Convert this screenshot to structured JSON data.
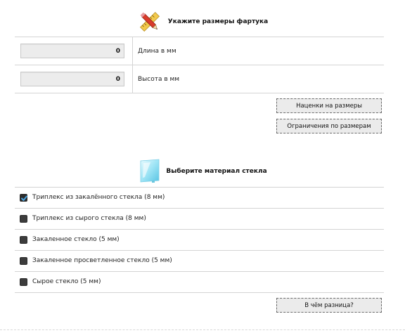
{
  "dimensions_section": {
    "title": "Укажите размеры фартука",
    "icon": "ruler-pencil-icon",
    "length_value": "0",
    "length_label": "Длина в мм",
    "height_value": "0",
    "height_label": "Высота в мм",
    "markup_button": "Наценки на размеры",
    "limits_button": "Ограничения по размерам"
  },
  "material_section": {
    "title": "Выберите материал стекла",
    "icon": "glass-pane-icon",
    "options": [
      {
        "label": "Триплекс из закалённого стекла (8 мм)",
        "checked": true
      },
      {
        "label": "Триплекс из сырого стекла (8 мм)",
        "checked": false
      },
      {
        "label": "Закаленное стекло (5 мм)",
        "checked": false
      },
      {
        "label": "Закаленное просветленное стекло (5 мм)",
        "checked": false
      },
      {
        "label": "Сырое стекло (5 мм)",
        "checked": false
      }
    ],
    "difference_button": "В чём разница?"
  },
  "colors": {
    "accent_check": "#4aa3df",
    "divider": "#d4d4d4",
    "input_bg": "#ececec"
  }
}
